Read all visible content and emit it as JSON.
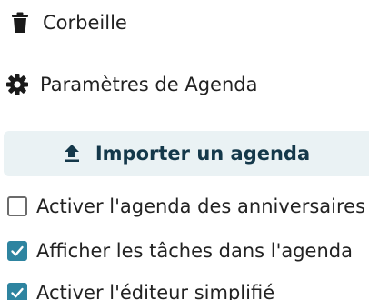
{
  "nav": {
    "trash_label": "Corbeille",
    "settings_label": "Paramètres de Agenda"
  },
  "import_button": {
    "label": "Importer un agenda"
  },
  "settings": {
    "birthday_calendar": {
      "label": "Activer l'agenda des anniversaires",
      "checked": false
    },
    "show_tasks": {
      "label": "Afficher les tâches dans l'agenda",
      "checked": true
    },
    "simple_editor": {
      "label": "Activer l'éditeur simplifié",
      "checked": true
    }
  },
  "colors": {
    "accent": "#2e84a0",
    "import_bg": "#eaf2f4",
    "import_text": "#14384a"
  },
  "icons": {
    "trash": "trash-icon",
    "settings": "gear-icon",
    "import": "upload-icon",
    "check": "checkmark-icon"
  }
}
